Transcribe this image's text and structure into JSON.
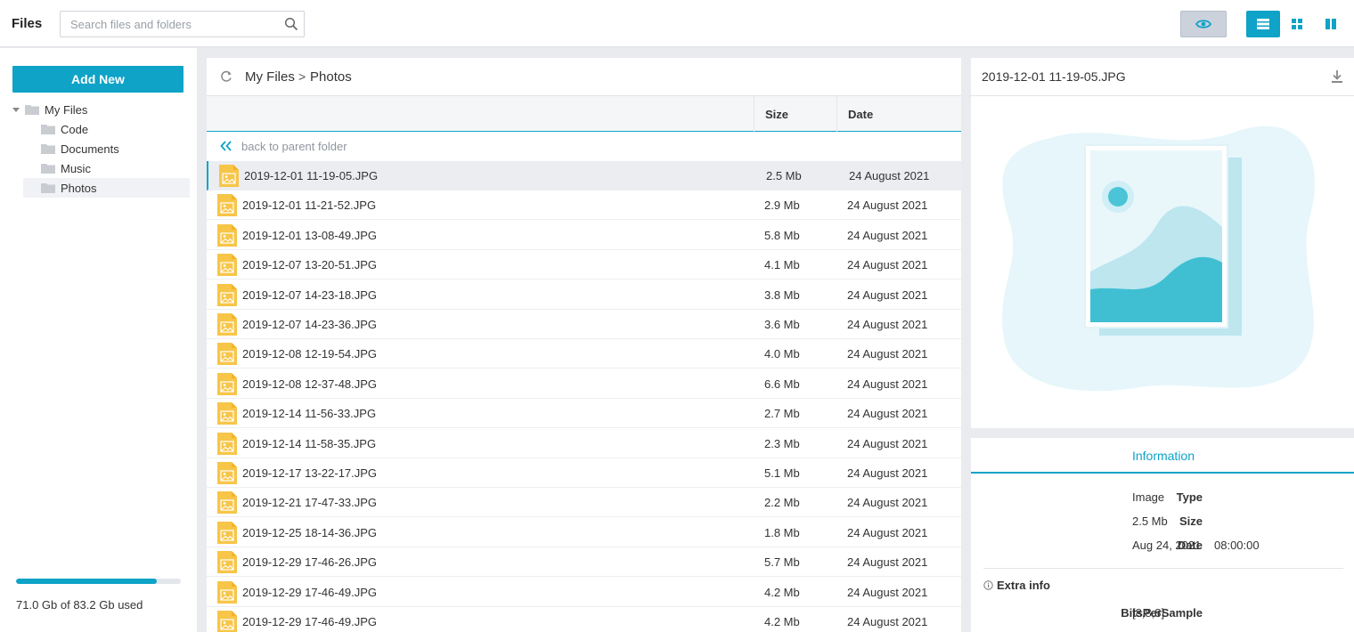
{
  "app": {
    "title": "Files"
  },
  "search": {
    "placeholder": "Search files and folders",
    "icon": "search-icon"
  },
  "toolbar": {
    "preview_icon": "eye-icon",
    "view_modes": [
      "list-view-icon",
      "tiles-view-icon",
      "split-view-icon"
    ],
    "accent": "#0ea3c7"
  },
  "sidebar": {
    "add_new_label": "Add New",
    "tree": [
      {
        "label": "My Files",
        "level": 0,
        "expanded": true,
        "selected": false
      },
      {
        "label": "Code",
        "level": 1,
        "selected": false
      },
      {
        "label": "Documents",
        "level": 1,
        "selected": false
      },
      {
        "label": "Music",
        "level": 1,
        "selected": false
      },
      {
        "label": "Photos",
        "level": 1,
        "selected": true
      }
    ],
    "usage_text": "71.0 Gb of 83.2 Gb used",
    "usage_fraction": 0.853
  },
  "main": {
    "breadcrumb": [
      "My Files",
      "Photos"
    ],
    "breadcrumb_separator": ">",
    "columns": {
      "size": "Size",
      "date": "Date"
    },
    "back_label": "back to parent folder",
    "files": [
      {
        "name": "2019-12-01 11-19-05.JPG",
        "size": "2.5 Mb",
        "date": "24 August 2021",
        "selected": true
      },
      {
        "name": "2019-12-01 11-21-52.JPG",
        "size": "2.9 Mb",
        "date": "24 August 2021"
      },
      {
        "name": "2019-12-01 13-08-49.JPG",
        "size": "5.8 Mb",
        "date": "24 August 2021"
      },
      {
        "name": "2019-12-07 13-20-51.JPG",
        "size": "4.1 Mb",
        "date": "24 August 2021"
      },
      {
        "name": "2019-12-07 14-23-18.JPG",
        "size": "3.8 Mb",
        "date": "24 August 2021"
      },
      {
        "name": "2019-12-07 14-23-36.JPG",
        "size": "3.6 Mb",
        "date": "24 August 2021"
      },
      {
        "name": "2019-12-08 12-19-54.JPG",
        "size": "4.0 Mb",
        "date": "24 August 2021"
      },
      {
        "name": "2019-12-08 12-37-48.JPG",
        "size": "6.6 Mb",
        "date": "24 August 2021"
      },
      {
        "name": "2019-12-14 11-56-33.JPG",
        "size": "2.7 Mb",
        "date": "24 August 2021"
      },
      {
        "name": "2019-12-14 11-58-35.JPG",
        "size": "2.3 Mb",
        "date": "24 August 2021"
      },
      {
        "name": "2019-12-17 13-22-17.JPG",
        "size": "5.1 Mb",
        "date": "24 August 2021"
      },
      {
        "name": "2019-12-21 17-47-33.JPG",
        "size": "2.2 Mb",
        "date": "24 August 2021"
      },
      {
        "name": "2019-12-25 18-14-36.JPG",
        "size": "1.8 Mb",
        "date": "24 August 2021"
      },
      {
        "name": "2019-12-29 17-46-26.JPG",
        "size": "5.7 Mb",
        "date": "24 August 2021"
      },
      {
        "name": "2019-12-29 17-46-49.JPG",
        "size": "4.2 Mb",
        "date": "24 August 2021"
      },
      {
        "name": "2019-12-29 17-46-49.JPG",
        "size": "4.2 Mb",
        "date": "24 August 2021"
      }
    ]
  },
  "preview": {
    "title": "2019-12-01 11-19-05.JPG",
    "download_icon": "download-icon",
    "image_icon": "image-placeholder-icon"
  },
  "info": {
    "tab_label": "Information",
    "type_key": "Type",
    "type_val": "Image",
    "size_key": "Size",
    "size_val": "2.5 Mb",
    "date_key": "Date",
    "date_val": "Aug 24, 2021",
    "time_val": "08:00:00",
    "extra_title": "Extra info",
    "extra_key": "BitsPerSample",
    "extra_val": "[8,8,8]"
  }
}
